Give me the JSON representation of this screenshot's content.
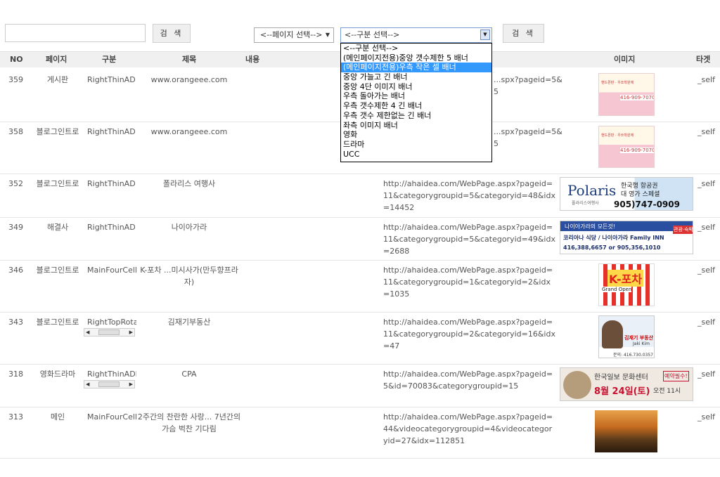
{
  "search": {
    "value": "",
    "button_label": "검 색"
  },
  "page_select": {
    "value": "<--페이지 선택-->"
  },
  "category_select": {
    "value": "<--구분 선택-->",
    "options": [
      "<--구분 선택-->",
      "(메인페이지전용)중앙 갯수제한 5 배너",
      "(메인페이지전용)우측 작은 셀 배너",
      "중앙 가늘고 긴 배너",
      "중앙 4단 이미지 배너",
      "우측 돌아가는 배너",
      "우측 갯수제한 4 긴 배너",
      "우측 갯수 제한없는 긴 배너",
      "좌측 이미지 배너",
      "영화",
      "드라마",
      "UCC"
    ],
    "highlighted_index": 2
  },
  "search_button2_label": "검 색",
  "columns": {
    "no": "NO",
    "page": "페이지",
    "gubun": "구분",
    "title": "제목",
    "content": "내용",
    "image": "이미지",
    "target": "타겟"
  },
  "rows": [
    {
      "no": "359",
      "page": "게시판",
      "gubun": "RightThinAD",
      "title": "www.orangeee.com",
      "url": "...spx?pageid=5&\n5",
      "target": "_self"
    },
    {
      "no": "358",
      "page": "블로그인트로",
      "gubun": "RightThinAD",
      "title": "www.orangeee.com",
      "url": "...spx?pageid=5&\n5",
      "target": "_self"
    },
    {
      "no": "352",
      "page": "블로그인트로",
      "gubun": "RightThinAD",
      "title": "폴라리스 여행사",
      "url": "http://ahaidea.com/WebPage.aspx?pageid=11&categorygroupid=5&categoryid=48&idx=14452",
      "target": "_self"
    },
    {
      "no": "349",
      "page": "해결사",
      "gubun": "RightThinAD",
      "title": "나이아가라",
      "url": "http://ahaidea.com/WebPage.aspx?pageid=11&categorygroupid=5&categoryid=49&idx=2688",
      "target": "_self"
    },
    {
      "no": "346",
      "page": "블로그인트로",
      "gubun": "MainFourCell",
      "title": "K-포차 ...미시사가(만두향프라자)",
      "url": "http://ahaidea.com/WebPage.aspx?pageid=11&categorygroupid=1&categoryid=2&idx=1035",
      "target": "_self"
    },
    {
      "no": "343",
      "page": "블로그인트로",
      "gubun": "RightTopRotat",
      "title": "김재기부동산",
      "url": "http://ahaidea.com/WebPage.aspx?pageid=11&categorygroupid=2&categoryid=16&idx=47",
      "target": "_self"
    },
    {
      "no": "318",
      "page": "영화드라마",
      "gubun": "RightThinADMı",
      "title": "CPA",
      "url": "http://ahaidea.com/WebPage.aspx?pageid=5&id=70083&categorygroupid=15",
      "target": "_self"
    },
    {
      "no": "313",
      "page": "메인",
      "gubun": "MainFourCell",
      "title": "2주간의 찬란한 사랑... 7년간의 가슴 벅찬 기다림",
      "url": "http://ahaidea.com/WebPage.aspx?pageid=44&videocategorygroupid=4&videocategoryid=27&idx=112851",
      "target": "_self"
    }
  ],
  "ads": {
    "polaris": {
      "brand": "Polaris",
      "sub": "폴라리스여행사",
      "line1": "한국행 항공권",
      "line2": "대 영가 스페셜",
      "phone": "905)747-0909"
    },
    "niagara": {
      "line1": "나이아가라의 모든것!",
      "line2": "코리아나 식당 / 나이아가라 Family INN",
      "phone": "416,388,6657 or 905,356,1010",
      "badge": "관광·숙박"
    },
    "kpocha": {
      "brand": "K-포차",
      "sub": "Grand Open"
    },
    "realtor": {
      "name": "김재기 부동산",
      "en": "Jaki Kim",
      "phone": "문의: 416.730.0357"
    },
    "cpa": {
      "line1": "한국일보 문화센터",
      "date": "8월 24일(토)",
      "time": "오전 11시",
      "badge": "예약필수!"
    },
    "orange": {
      "title": "핸드폰판 · 우쏘학원에",
      "phone": "416-909-7070"
    }
  }
}
